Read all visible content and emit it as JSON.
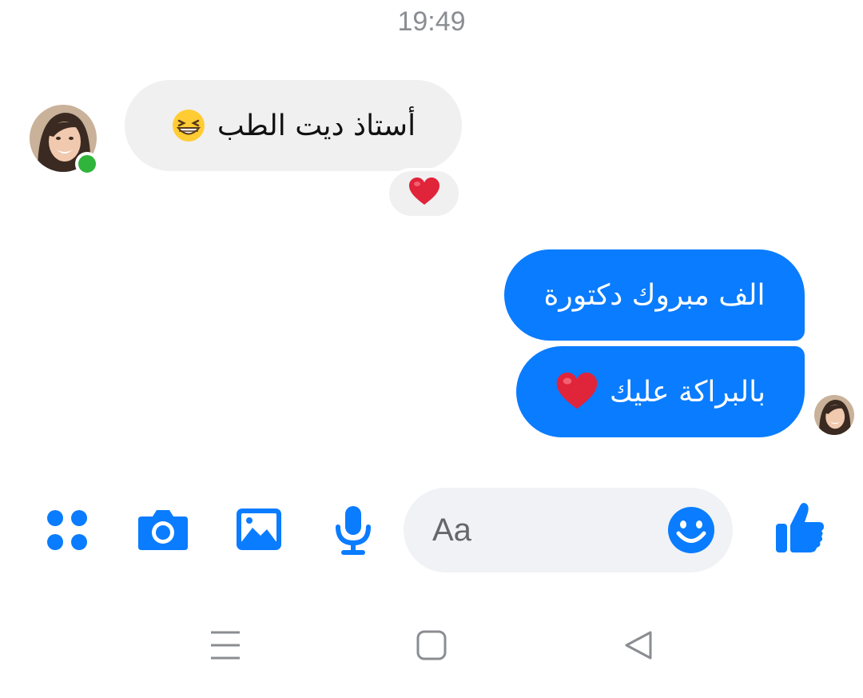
{
  "chat": {
    "timestamp": "19:49",
    "incoming": {
      "text": "أستاذ ديت الطب",
      "emoji": "grinning-squinting-face",
      "reaction": "red-heart",
      "sender_online": true
    },
    "outgoing": [
      {
        "text": "الف مبروك دكتورة"
      },
      {
        "text": "بالبراكة عليك",
        "emoji": "red-heart"
      }
    ]
  },
  "composer": {
    "placeholder": "Aa",
    "icons": [
      "apps-icon",
      "camera-icon",
      "gallery-icon",
      "microphone-icon",
      "emoji-icon",
      "thumbs-up-icon"
    ]
  },
  "nav": {
    "icons": [
      "menu-icon",
      "home-icon",
      "back-icon"
    ]
  },
  "colors": {
    "accent": "#0a7cff",
    "incoming_bubble": "#f0f0f0",
    "online": "#31b43b"
  }
}
